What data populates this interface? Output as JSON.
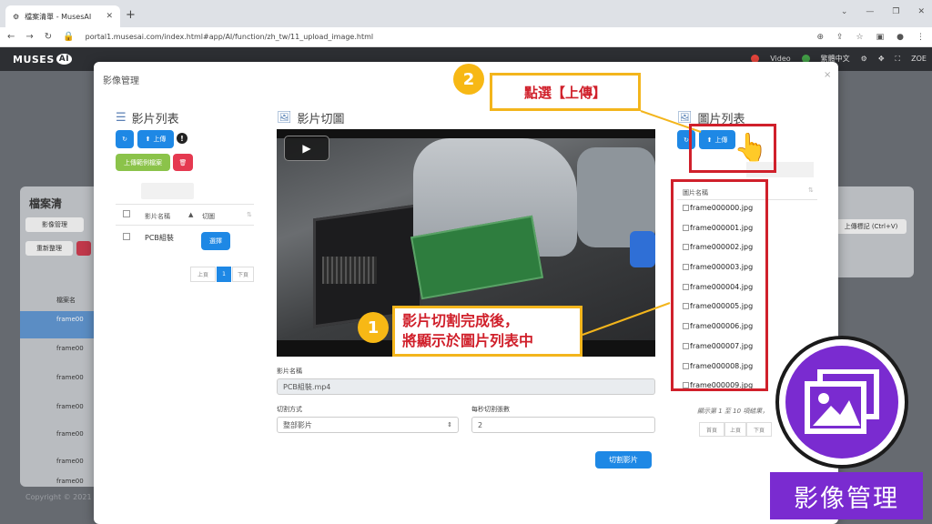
{
  "browser": {
    "tab_title": "檔案清單 - MusesAI",
    "url": "portal1.musesai.com/index.html#app/AI/function/zh_tw/11_upload_image.html"
  },
  "app": {
    "logo_text": "MUSES",
    "logo_ai": "AI",
    "video_menu": "Video",
    "lang_menu": "繁體中文",
    "user": "ZOE"
  },
  "background": {
    "card_title": "檔案清",
    "btn_img_mgmt": "影像管理",
    "btn_refresh": "重新整理",
    "col_name": "檔案名",
    "rows": [
      "frame00",
      "frame00",
      "frame00",
      "frame00",
      "frame00",
      "frame00",
      "frame00"
    ],
    "right_hint": "上傳標記 (Ctrl+V)",
    "copyright": "Copyright © 2021 -"
  },
  "modal": {
    "title": "影像管理",
    "close": "×"
  },
  "video_list": {
    "title": "影片列表",
    "upload_label": "上傳",
    "upload_sample_label": "上傳範例檔案",
    "col_name": "影片名稱",
    "col_cut": "切圖",
    "rows": [
      {
        "name": "PCB組裝",
        "action": "選擇"
      }
    ],
    "pager": {
      "prev": "上頁",
      "current": "1",
      "next": "下頁"
    }
  },
  "video_cut": {
    "title": "影片切圖",
    "video_name_label": "影片名稱",
    "video_name_value": "PCB組裝.mp4",
    "cut_mode_label": "切割方式",
    "cut_mode_value": "整部影片",
    "per_sec_label": "每秒切割張數",
    "per_sec_value": "2",
    "cut_button": "切割影片"
  },
  "image_list": {
    "title": "圖片列表",
    "upload_label": "上傳",
    "col_name": "圖片名稱",
    "items": [
      "frame000000.jpg",
      "frame000001.jpg",
      "frame000002.jpg",
      "frame000003.jpg",
      "frame000004.jpg",
      "frame000005.jpg",
      "frame000006.jpg",
      "frame000007.jpg",
      "frame000008.jpg",
      "frame000009.jpg"
    ],
    "summary": "顯示第 1 至 10 項結果，",
    "pager": {
      "first": "首頁",
      "prev": "上頁",
      "next": "下頁"
    }
  },
  "annotations": {
    "step1_number": "1",
    "step1_text_line1": "影片切割完成後，",
    "step1_text_line2": "將顯示於圖片列表中",
    "step2_number": "2",
    "step2_text": "點選【上傳】",
    "badge_label": "影像管理"
  },
  "colors": {
    "primary_blue": "#1e88e5",
    "annotation_red": "#d0202b",
    "annotation_yellow": "#f7b815",
    "badge_purple": "#7a2bd0",
    "green": "#8bc34a"
  }
}
